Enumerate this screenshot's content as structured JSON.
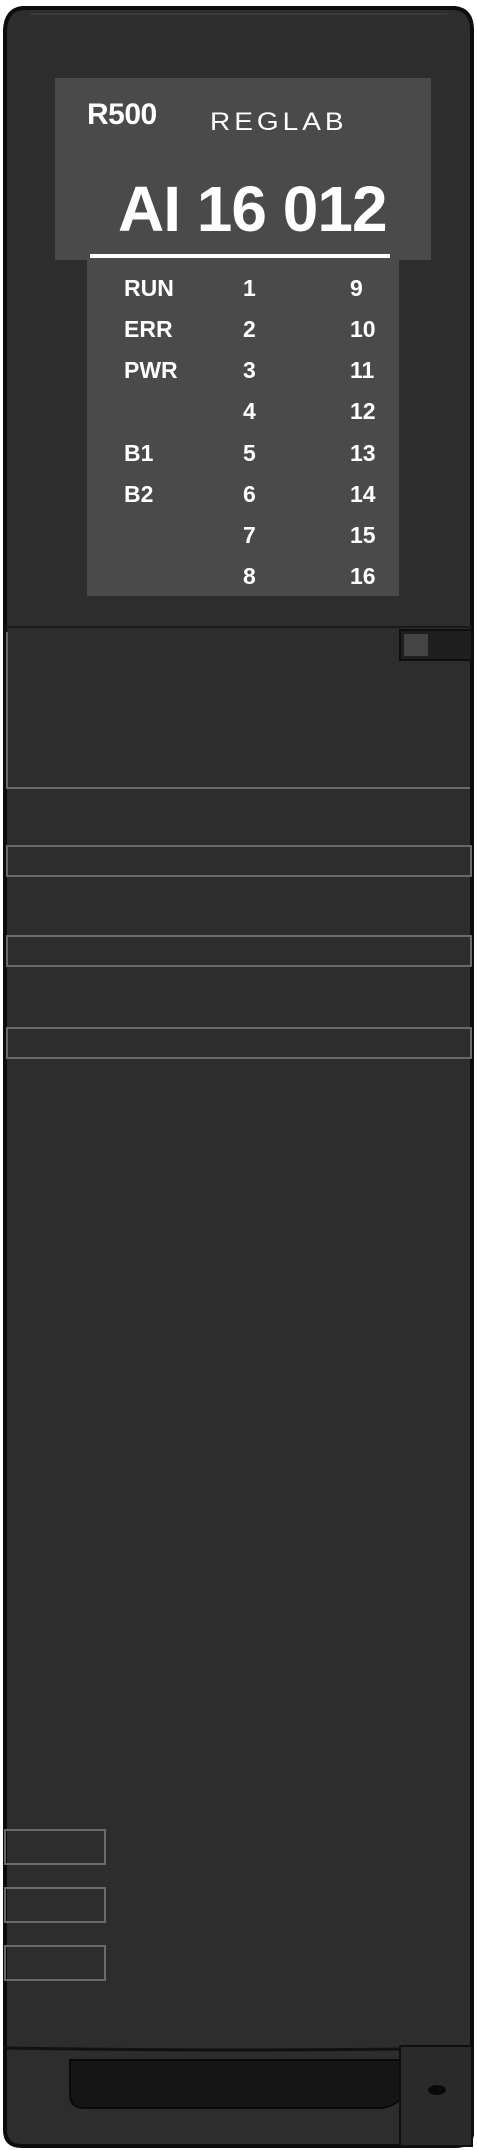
{
  "module": {
    "series": "R500",
    "brand": "REGLAB",
    "model": "AI 16 012",
    "colors": {
      "body": "#2d2d2d",
      "body_edge": "#111111",
      "label_panel": "#4a4a4a",
      "text": "#ffffff"
    }
  },
  "led_rows": [
    {
      "name": "RUN",
      "left": "1",
      "right": "9"
    },
    {
      "name": "ERR",
      "left": "2",
      "right": "10"
    },
    {
      "name": "PWR",
      "left": "3",
      "right": "11"
    },
    {
      "name": "",
      "left": "4",
      "right": "12"
    },
    {
      "name": "B1",
      "left": "5",
      "right": "13"
    },
    {
      "name": "B2",
      "left": "6",
      "right": "14"
    },
    {
      "name": "",
      "left": "7",
      "right": "15"
    },
    {
      "name": "",
      "left": "8",
      "right": "16"
    }
  ]
}
